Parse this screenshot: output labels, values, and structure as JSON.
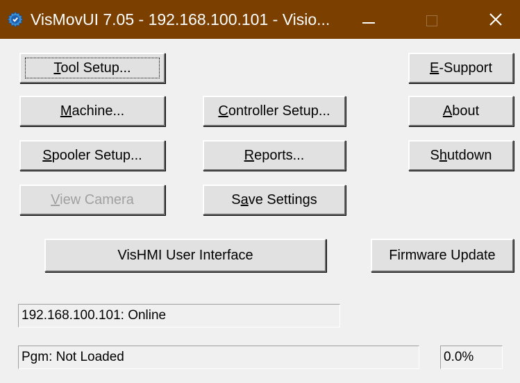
{
  "window": {
    "title": "VisMovUI 7.05 - 192.168.100.101 - Visio...",
    "titlebar_color": "#7b3f00",
    "icon": "gear-check-icon"
  },
  "buttons": {
    "tool_setup": {
      "pre": "",
      "key": "T",
      "post": "ool Setup..."
    },
    "e_support": {
      "pre": "",
      "key": "E",
      "post": "-Support"
    },
    "machine": {
      "pre": "",
      "key": "M",
      "post": "achine..."
    },
    "controller_setup": {
      "pre": "",
      "key": "C",
      "post": "ontroller Setup..."
    },
    "about": {
      "pre": "",
      "key": "A",
      "post": "bout"
    },
    "spooler_setup": {
      "pre": "",
      "key": "S",
      "post": "pooler Setup..."
    },
    "reports": {
      "pre": "",
      "key": "R",
      "post": "eports..."
    },
    "shutdown": {
      "pre": "S",
      "key": "h",
      "post": "utdown"
    },
    "view_camera": {
      "pre": "",
      "key": "V",
      "post": "iew Camera",
      "disabled": true
    },
    "save_settings": {
      "pre": "S",
      "key": "a",
      "post": "ve Settings"
    },
    "vishmi": {
      "label": "VisHMI User Interface"
    },
    "firmware_update": {
      "label": "Firmware Update"
    }
  },
  "status": {
    "connection": "192.168.100.101: Online",
    "program": "Pgm: Not Loaded",
    "progress": "0.0%"
  }
}
